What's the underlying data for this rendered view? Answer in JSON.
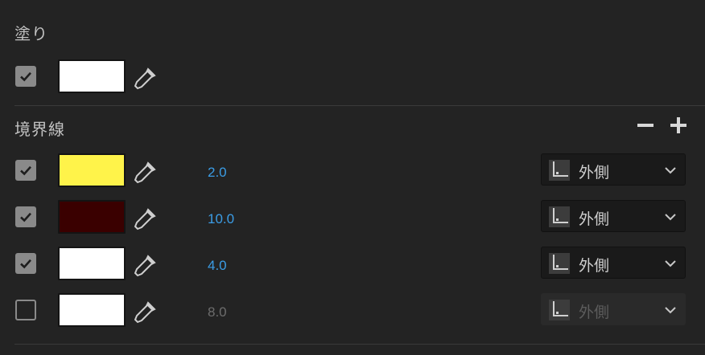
{
  "fill": {
    "title": "塗り",
    "row": {
      "checked": true,
      "color": "#ffffff"
    }
  },
  "stroke": {
    "title": "境界線",
    "rows": [
      {
        "checked": true,
        "color": "#fff34a",
        "value": "2.0",
        "position": "外側",
        "enabled": true
      },
      {
        "checked": true,
        "color": "#3a0000",
        "value": "10.0",
        "position": "外側",
        "enabled": true
      },
      {
        "checked": true,
        "color": "#ffffff",
        "value": "4.0",
        "position": "外側",
        "enabled": true
      },
      {
        "checked": false,
        "color": "#ffffff",
        "value": "8.0",
        "position": "外側",
        "enabled": false
      }
    ]
  },
  "colors": {
    "accent": "#3b9de6"
  },
  "icons": [
    "checkmark-icon",
    "eyedropper-icon",
    "minus-icon",
    "plus-icon",
    "stroke-position-icon",
    "chevron-down-icon"
  ]
}
